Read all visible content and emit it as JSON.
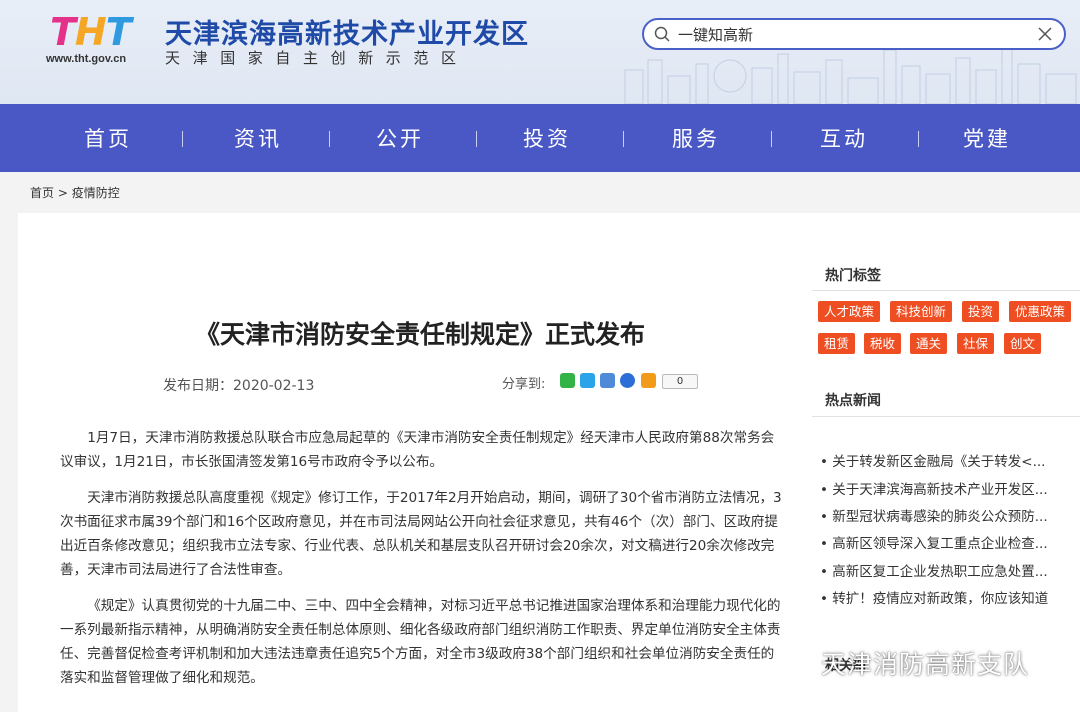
{
  "header": {
    "logo_text": "THT",
    "logo_url": "www.tht.gov.cn",
    "site_name": "天津滨海高新技术产业开发区",
    "site_sub": "天津国家自主创新示范区"
  },
  "search": {
    "value": "一键知高新",
    "icon": "search-icon",
    "clear_icon": "close-icon"
  },
  "nav": [
    {
      "label": "首页"
    },
    {
      "label": "资讯"
    },
    {
      "label": "公开"
    },
    {
      "label": "投资"
    },
    {
      "label": "服务"
    },
    {
      "label": "互动"
    },
    {
      "label": "党建"
    }
  ],
  "breadcrumb": {
    "home": "首页",
    "sep": " > ",
    "current": "疫情防控"
  },
  "article": {
    "title": "《天津市消防安全责任制规定》正式发布",
    "date_label": "发布日期：",
    "date": "2020-02-13",
    "share_label": "分享到:",
    "share_count": "0",
    "paragraphs": [
      "1月7日，天津市消防救援总队联合市应急局起草的《天津市消防安全责任制规定》经天津市人民政府第88次常务会议审议，1月21日，市长张国清签发第16号市政府令予以公布。",
      "天津市消防救援总队高度重视《规定》修订工作，于2017年2月开始启动，期间，调研了30个省市消防立法情况，3次书面征求市属39个部门和16个区政府意见，并在市司法局网站公开向社会征求意见，共有46个（次）部门、区政府提出近百条修改意见；组织我市立法专家、行业代表、总队机关和基层支队召开研讨会20余次，对文稿进行20余次修改完善，天津市司法局进行了合法性审查。",
      "《规定》认真贯彻党的十九届二中、三中、四中全会精神，对标习近平总书记推进国家治理体系和治理能力现代化的一系列最新指示精神，从明确消防安全责任制总体原则、细化各级政府部门组织消防工作职责、界定单位消防安全主体责任、完善督促检查考评机制和加大违法违章责任追究5个方面，对全市3级政府38个部门组织和社会单位消防安全责任的落实和监督管理做了细化和规范。"
    ]
  },
  "sidebar": {
    "tags_title": "热门标签",
    "tags": [
      "人才政策",
      "科技创新",
      "投资",
      "优惠政策",
      "租赁",
      "税收",
      "通关",
      "社保",
      "创文"
    ],
    "news_title": "热点新闻",
    "news": [
      "关于转发新区金融局《关于转发<...",
      "关于天津滨海高新技术产业开发区...",
      "新型冠状病毒感染的肺炎公众预防...",
      "高新区领导深入复工重点企业检查...",
      "高新区复工企业发热职工应急处置...",
      "转扩！疫情应对新政策，你应该知道"
    ],
    "partial_title": "相关新"
  },
  "watermark": "天津消防高新支队",
  "colors": {
    "nav": "#4a58c5",
    "tag": "#ef4e22",
    "brand_blue": "#1f4aa8"
  }
}
